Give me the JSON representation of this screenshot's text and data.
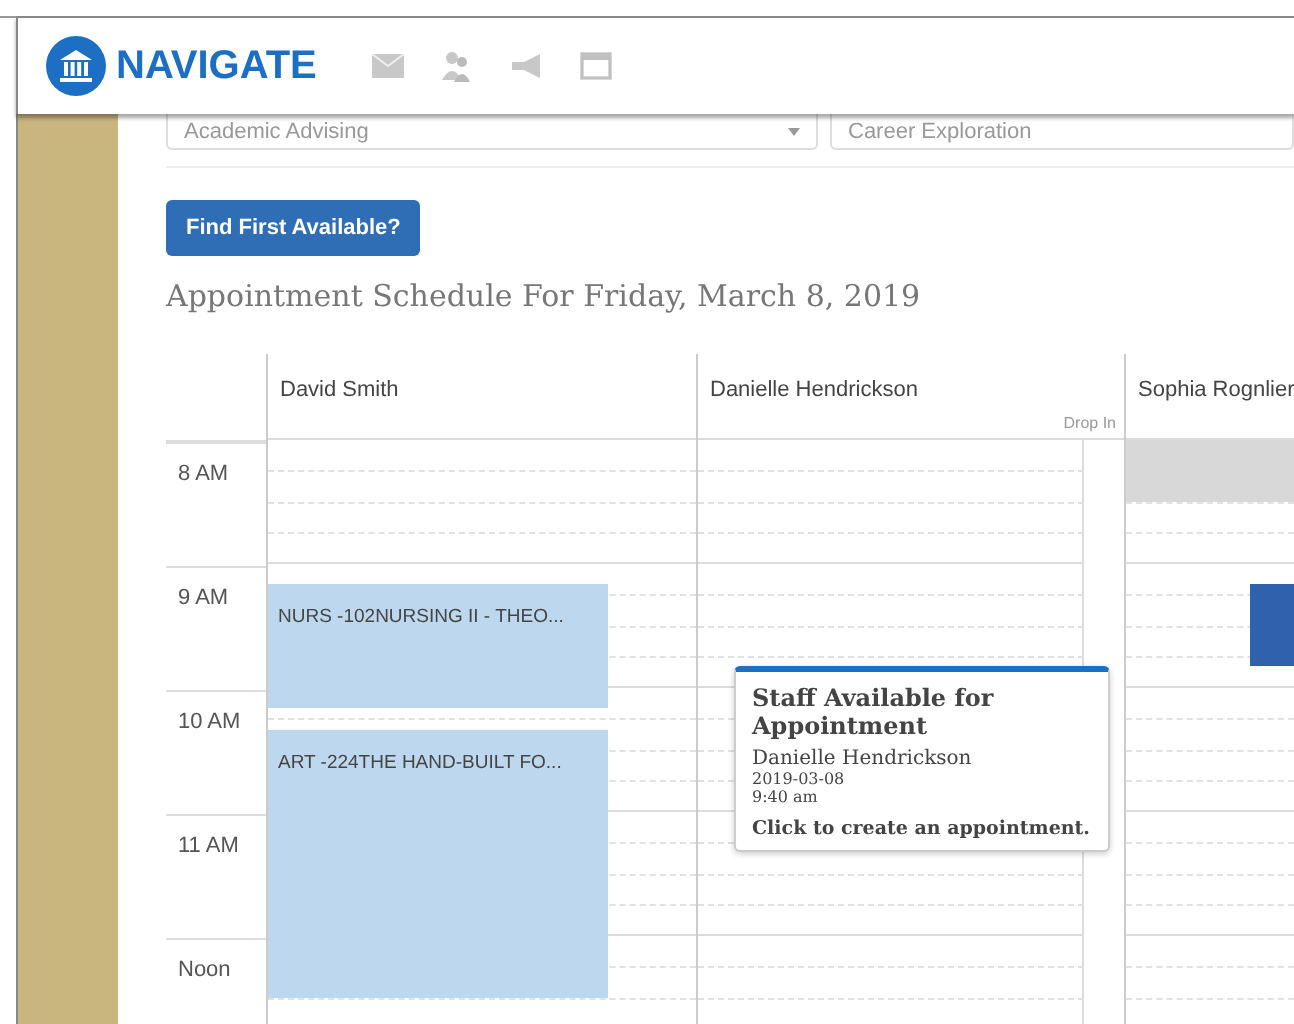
{
  "header": {
    "brand": "NAVIGATE"
  },
  "filters": [
    {
      "value": "Academic Advising"
    },
    {
      "value": "Career Exploration"
    }
  ],
  "find_button": "Find First Available?",
  "schedule_title": "Appointment Schedule For Friday, March 8, 2019",
  "hours": [
    "8 AM",
    "9 AM",
    "10 AM",
    "11 AM",
    "Noon"
  ],
  "columns": [
    {
      "name": "David Smith",
      "events": [
        {
          "kind": "class",
          "title": "NURS -102NURSING II - THEO..."
        },
        {
          "kind": "class",
          "title": "ART -224THE HAND-BUILT FO..."
        }
      ]
    },
    {
      "name": "Danielle Hendrickson",
      "drop_in": "Drop In"
    },
    {
      "name": "Sophia Rognlier",
      "events": [
        {
          "kind": "unavailable"
        },
        {
          "kind": "booked"
        }
      ]
    }
  ],
  "tooltip": {
    "title": "Staff Available for Appointment",
    "staff": "Danielle Hendrickson",
    "date": "2019-03-08",
    "time": "9:40 am",
    "hint": "Click to create an appointment."
  }
}
